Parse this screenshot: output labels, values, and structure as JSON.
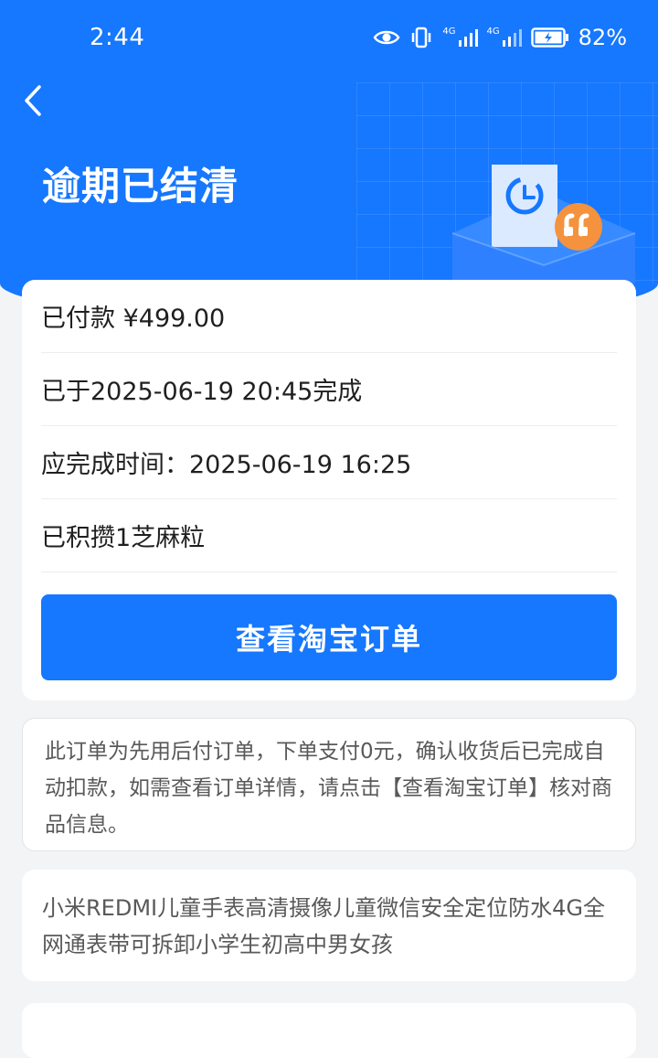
{
  "status_bar": {
    "time": "2:44",
    "network_1": "4G",
    "network_2": "4G",
    "battery": "82%"
  },
  "header": {
    "title": "逾期已结清",
    "back_icon": "chevron-left-icon"
  },
  "summary": {
    "paid": "已付款 ¥499.00",
    "completed_at": "已于2025-06-19 20:45完成",
    "due_time": "应完成时间：2025-06-19 16:25",
    "points": "已积攒1芝麻粒",
    "button_label": "查看淘宝订单"
  },
  "note": {
    "text": "此订单为先用后付订单，下单支付0元，确认收货后已完成自动扣款，如需查看订单详情，请点击【查看淘宝订单】核对商品信息。"
  },
  "product": {
    "title": "小米REDMI儿童手表高清摄像儿童微信安全定位防水4G全网通表带可拆卸小学生初高中男女孩"
  },
  "colors": {
    "brand_blue": "#1677ff",
    "badge_orange": "#f5923e",
    "page_bg": "#f3f4f6"
  }
}
